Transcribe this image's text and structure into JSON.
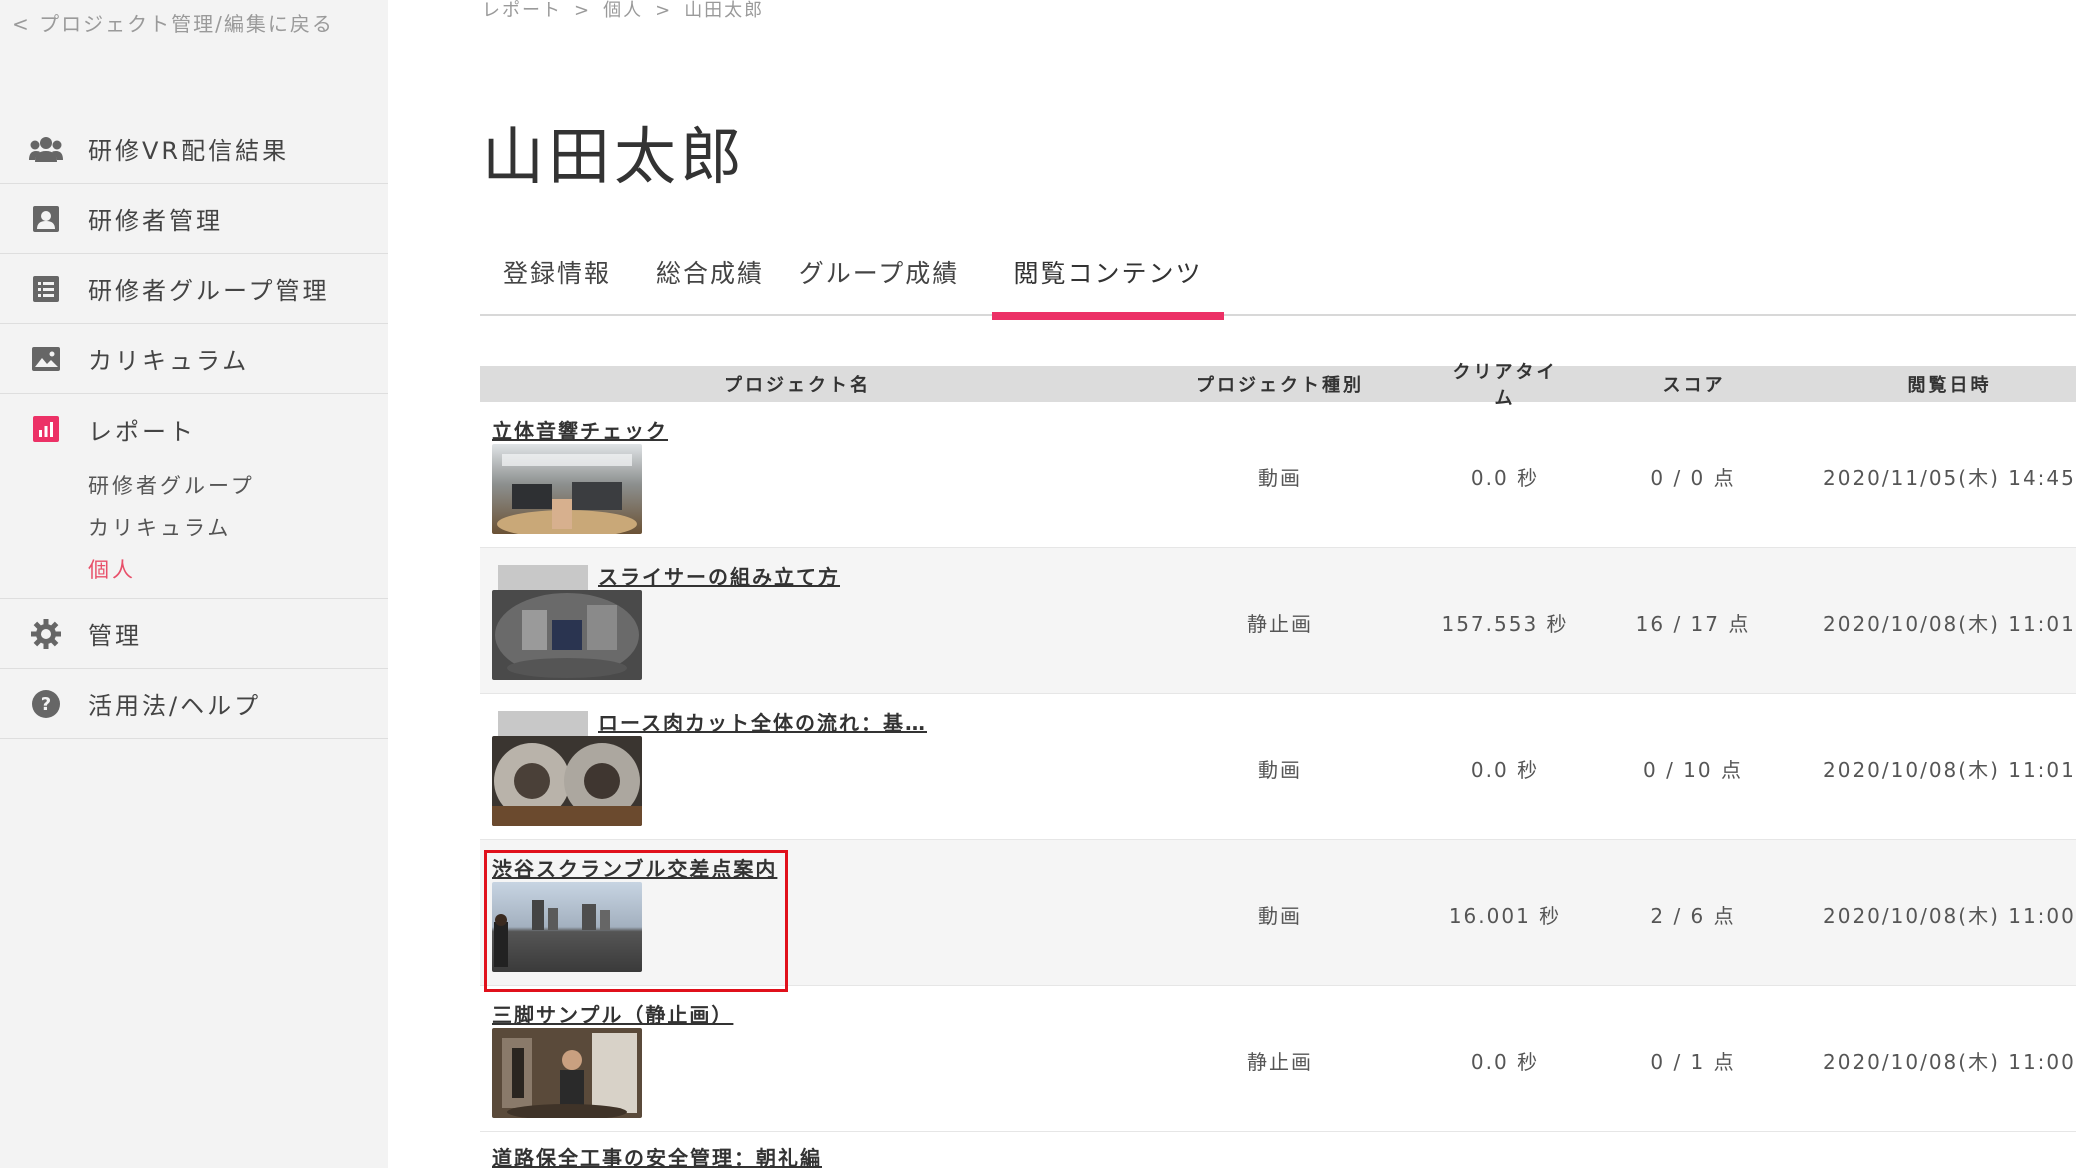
{
  "sidebar": {
    "back_link": "< プロジェクト管理/編集に戻る",
    "items": [
      {
        "label": "研修VR配信結果",
        "icon": "users-icon"
      },
      {
        "label": "研修者管理",
        "icon": "person-badge-icon"
      },
      {
        "label": "研修者グループ管理",
        "icon": "list-icon"
      },
      {
        "label": "カリキュラム",
        "icon": "image-icon"
      },
      {
        "label": "レポート",
        "icon": "bar-chart-icon"
      },
      {
        "label": "管理",
        "icon": "gear-icon"
      },
      {
        "label": "活用法/ヘルプ",
        "icon": "help-icon"
      }
    ],
    "report_sub": [
      "研修者グループ",
      "カリキュラム",
      "個人"
    ],
    "active_color": "#e8506a"
  },
  "breadcrumb": [
    "レポート",
    "個人",
    "山田太郎"
  ],
  "breadcrumb_sep": ">",
  "page_title": "山田太郎",
  "tabs": [
    "登録情報",
    "総合成績",
    "グループ成績",
    "閲覧コンテンツ"
  ],
  "active_tab_index": 3,
  "accent_color": "#ec3166",
  "table": {
    "headers": [
      "プロジェクト名",
      "プロジェクト種別",
      "クリアタイム",
      "スコア",
      "閲覧日時"
    ],
    "rows": [
      {
        "name": "立体音響チェック",
        "type": "動画",
        "clear_time": "0.0 秒",
        "score": "0 / 0 点",
        "date": "2020/11/05(木) 14:45"
      },
      {
        "name": "スライサーの組み立て方",
        "type": "静止画",
        "clear_time": "157.553 秒",
        "score": "16 / 17 点",
        "date": "2020/10/08(木) 11:01"
      },
      {
        "name": "ロース肉カット全体の流れ：基…",
        "type": "動画",
        "clear_time": "0.0 秒",
        "score": "0 / 10 点",
        "date": "2020/10/08(木) 11:01"
      },
      {
        "name": "渋谷スクランブル交差点案内",
        "type": "動画",
        "clear_time": "16.001 秒",
        "score": "2 / 6 点",
        "date": "2020/10/08(木) 11:00"
      },
      {
        "name": "三脚サンプル（静止画）",
        "type": "静止画",
        "clear_time": "0.0 秒",
        "score": "0 / 1 点",
        "date": "2020/10/08(木) 11:00"
      }
    ],
    "partial_row_name": "道路保全工事の安全管理：朝礼編"
  }
}
